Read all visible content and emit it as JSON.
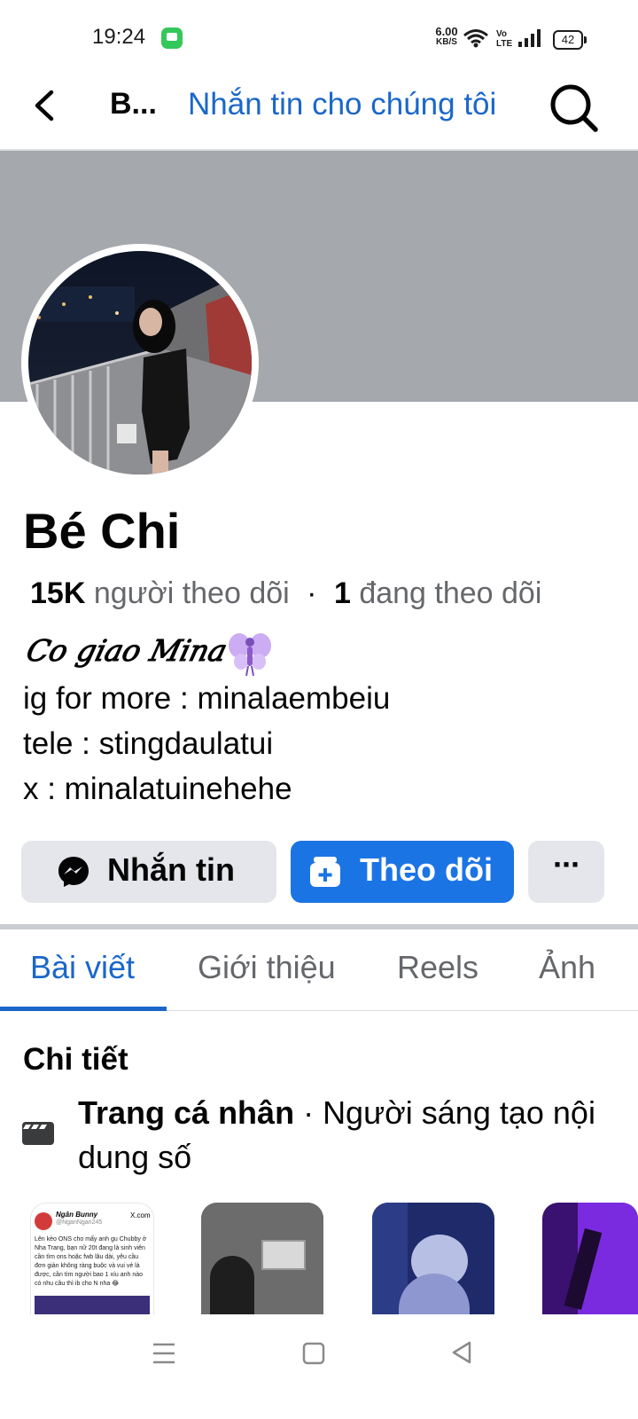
{
  "status_bar": {
    "time": "19:24",
    "net_speed_value": "6.00",
    "net_speed_unit": "KB/S",
    "volte_top": "Vo",
    "volte_bottom": "LTE",
    "battery": "42"
  },
  "header": {
    "title": "B...",
    "message_link": "Nhắn tin cho chúng tôi"
  },
  "profile": {
    "name": "Bé Chi",
    "followers_count": "15K",
    "followers_label": "người theo dõi",
    "separator": "·",
    "following_count": "1",
    "following_label": "đang theo dõi",
    "bio": [
      "𝐶𝑜 𝑔𝑖𝑎𝑜 𝑀𝑖𝑛𝑎",
      "ig for more : minalaembeiu",
      "tele : stingdaulatui",
      "x : minalatuinehehe"
    ]
  },
  "actions": {
    "message_label": "Nhắn tin",
    "follow_label": "Theo dõi",
    "more_label": "···"
  },
  "tabs": [
    {
      "label": "Bài viết",
      "active": true
    },
    {
      "label": "Giới thiệu",
      "active": false
    },
    {
      "label": "Reels",
      "active": false
    },
    {
      "label": "Ảnh",
      "active": false
    }
  ],
  "details": {
    "heading": "Chi tiết",
    "type_label": "Trang cá nhân",
    "type_separator": " · ",
    "category": "Người sáng tạo nội dung số"
  },
  "thumbnail_post": {
    "author": "Ngân Bunny",
    "handle": "@NganNgan245",
    "source": "X.com",
    "text": "Lên kèo ONS cho mấy anh gu Chubby ở Nha Trang, bạn nữ 20t đang là sinh viên cần tìm ons hoặc fwb lâu dài, yêu cầu đơn giản không ràng buộc và vui vẻ là được, cần tìm người bao 1 xíu anh nào có nhu cầu thì ib cho N nha 😂"
  },
  "colors": {
    "accent": "#1b74e4",
    "link": "#1a67c9",
    "cover": "#a5a8ac",
    "button_secondary": "#e4e6eb"
  }
}
